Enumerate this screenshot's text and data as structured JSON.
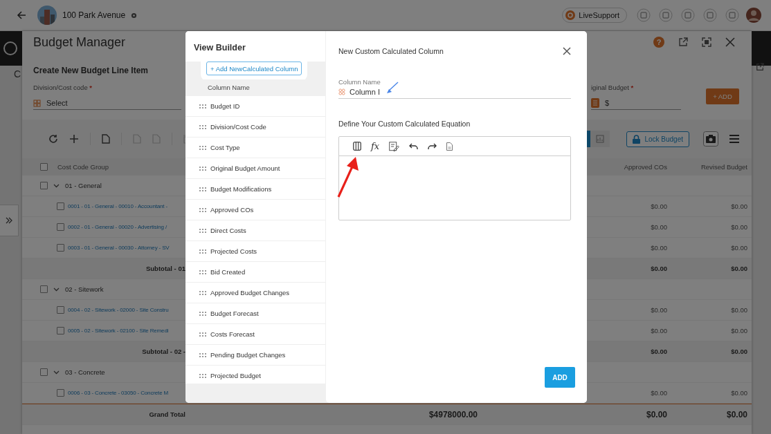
{
  "top_bar": {
    "project": "100 Park Avenue",
    "support_label": "LiveSupport"
  },
  "app_rail": {
    "tab_letter": "C"
  },
  "panel": {
    "title": "Budget Manager",
    "help_label": "?"
  },
  "create_form": {
    "title": "Create New Budget Line Item",
    "add_button": "+ ADD",
    "fields": [
      {
        "label": "Division/Cost code",
        "required_mark": "*",
        "placeholder": "Select"
      },
      {
        "label": "iginal Budget",
        "required_mark": "*",
        "value": "$"
      }
    ]
  },
  "toolbar": {
    "lock_button": "Lock Budget"
  },
  "table": {
    "all_checked": false,
    "columns": [
      "Cost Code Group",
      "Approved COs",
      "Revised Budget"
    ],
    "rows": [
      {
        "kind": "group",
        "label": "01 - General",
        "checked": false,
        "expanded": true
      },
      {
        "kind": "item",
        "label": "0001 - 01 - General - 00010 - Accountant -",
        "checked": false,
        "approved": "$0.00",
        "revised": "$0.00"
      },
      {
        "kind": "item",
        "label": "0002 - 01 - General - 00020 - Advertising /",
        "checked": false,
        "approved": "$0.00",
        "revised": "$0.00"
      },
      {
        "kind": "item",
        "label": "0003 - 01 - General - 00030 - Attorney - SV",
        "checked": false,
        "approved": "$0.00",
        "revised": "$0.00"
      },
      {
        "kind": "subtotal",
        "label": "Subtotal - 01",
        "approved": "$0.00",
        "revised": "$0.00"
      },
      {
        "kind": "group",
        "label": "02 - Sitework",
        "checked": false,
        "expanded": true
      },
      {
        "kind": "item",
        "label": "0004 - 02 - Sitework - 02000 - Site Constru",
        "checked": false,
        "approved": "$0.00",
        "revised": "$0.00"
      },
      {
        "kind": "item",
        "label": "0005 - 02 - Sitework - 02100 - Site Remedi",
        "checked": false,
        "approved": "$0.00",
        "revised": "$0.00"
      },
      {
        "kind": "subtotal",
        "label": "Subtotal - 02 -",
        "approved": "$0.00",
        "revised": "$0.00"
      },
      {
        "kind": "group",
        "label": "03 - Concrete",
        "checked": false,
        "expanded": true
      },
      {
        "kind": "item",
        "label": "0006 - 03 - Concrete - 03050 - Concrete M",
        "checked": false,
        "approved": "$0.00",
        "revised": "$0.00"
      },
      {
        "kind": "total",
        "label": "Grand Total",
        "middle": "$4978000.00",
        "approved": "$0.00",
        "revised": "$0.00"
      }
    ]
  },
  "view_builder": {
    "title": "View Builder",
    "add_button": "+ Add NewCalculated Column",
    "header": "Column Name",
    "columns": [
      "Budget ID",
      "Division/Cost Code",
      "Cost Type",
      "Original Budget Amount",
      "Budget Modifications",
      "Approved COs",
      "Direct Costs",
      "Projected Costs",
      "Bid Created",
      "Approved Budget Changes",
      "Budget Forecast",
      "Costs Forecast",
      "Pending Budget Changes",
      "Projected Budget"
    ]
  },
  "dialog": {
    "title": "New Custom Calculated Column",
    "field_label": "Column Name",
    "field_value": "Column I",
    "equation_label": "Define Your Custom Calculated Equation",
    "function_label": "fx",
    "add_button": "ADD"
  }
}
